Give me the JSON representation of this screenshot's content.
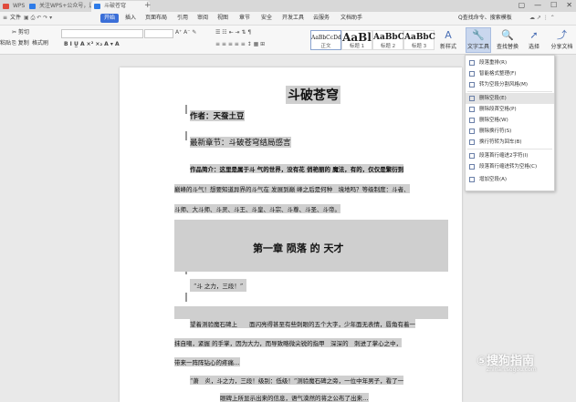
{
  "titlebar": {
    "tabs": [
      {
        "label": "WPS",
        "color": "#e04b3c"
      },
      {
        "label": "关注WPS+公众号，送随身模板",
        "color": "#2e7be8"
      },
      {
        "label": "斗破苍穹",
        "color": "#2e7be8"
      }
    ],
    "plus": "+",
    "window_buttons": [
      "▢",
      "—",
      "☐",
      "✕"
    ]
  },
  "menubar": {
    "file": "文件",
    "items": [
      "开始",
      "插入",
      "页面布局",
      "引用",
      "审阅",
      "视图",
      "章节",
      "安全",
      "开发工具",
      "云服务",
      "文档助手"
    ],
    "search_prompt": "Q查找命令、搜索模板"
  },
  "ribbon": {
    "cut": "剪切",
    "paste": "粘贴",
    "copy": "复制",
    "format_painter": "格式刷",
    "styles": [
      {
        "preview": "AaBbCcDd",
        "name": "正文"
      },
      {
        "preview": "AaBl",
        "name": "标题 1"
      },
      {
        "preview": "AaBbC",
        "name": "标题 2"
      },
      {
        "preview": "AaBbC",
        "name": "标题 3"
      }
    ],
    "new_style": "新样式",
    "text_tools": "文字工具",
    "find_replace": "查找替换",
    "select": "选择",
    "share": "分享文档"
  },
  "dropdown": {
    "items": [
      "段落重排(R)",
      "智能格式整理(F)",
      "转为空段分割风格(M)",
      "删除空段(E)",
      "删除段首空格(P)",
      "删除空格(W)",
      "删除换行符(S)",
      "换行符转为回车(B)",
      "段落首行缩进2字符(I)",
      "段落首行缩进转为空格(C)",
      "增加空段(A)"
    ]
  },
  "document": {
    "title": "斗破苍穹",
    "author": "作者：天蚕土豆",
    "latest": "最新章节：斗破苍穹结局感言",
    "intro": [
      "作品简介：这里是属于斗 气的世界，没有花 俏艳丽的 魔法，有的，仅仅是繁衍到",
      "巅峰的斗气！想要知道异界的斗气在 发展到巅 峰之后是何种　境地吗？等级制度：斗者、",
      "斗师、大斗师、斗灵、斗王、斗皇、斗宗、斗尊、斗圣、斗帝。"
    ],
    "chapter": "第一章 陨落 的 天才",
    "para1": "“斗 之力，三段！”",
    "para2": [
      "望着测验魔石碑上　　面闪亮得甚至有些刺眼的五个大字，少年面无表情，唇角有着一",
      "抹自嘲，紧握 的手掌，因为大力，而导致略微尖锐的指甲　深深的　刺进了掌心之中，",
      "带来一阵阵钻心的疼痛…"
    ],
    "para3": [
      "“萧　炎，斗之力，三段！级别：低级！”测验魔石碑之旁，一位中年男子，看了一",
      "眼碑上所显示出来的信息，语气漠然的将之公布了出来…"
    ]
  },
  "watermark": {
    "brand": "搜狗指南",
    "site": "zhinan.sogou.com"
  }
}
